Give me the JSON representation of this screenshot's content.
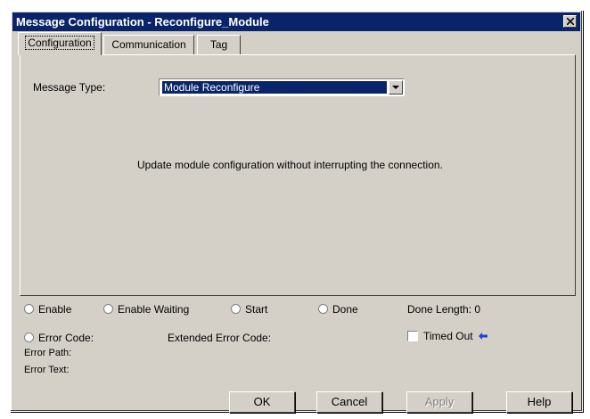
{
  "window": {
    "title": "Message Configuration - Reconfigure_Module"
  },
  "tabs": [
    {
      "label": "Configuration",
      "active": true
    },
    {
      "label": "Communication",
      "active": false
    },
    {
      "label": "Tag",
      "active": false
    }
  ],
  "config": {
    "message_type_label": "Message Type:",
    "message_type_value": "Module Reconfigure",
    "description": "Update module configuration without interrupting the connection."
  },
  "status": {
    "enable": "Enable",
    "enable_waiting": "Enable Waiting",
    "start": "Start",
    "done": "Done",
    "done_length": "Done Length: 0",
    "error_code": "Error Code:",
    "extended_error_code": "Extended Error Code:",
    "timed_out": "Timed Out",
    "error_path": "Error Path:",
    "error_text": "Error Text:"
  },
  "buttons": {
    "ok": "OK",
    "cancel": "Cancel",
    "apply": "Apply",
    "help": "Help"
  },
  "colors": {
    "titlebar": "#0a246a",
    "selection": "#0a246a",
    "arrow_accent": "#1f3fd6"
  },
  "icons": [
    "close-icon",
    "dropdown-arrow-icon",
    "radio-icon",
    "checkbox-icon",
    "arrow-left-icon"
  ]
}
